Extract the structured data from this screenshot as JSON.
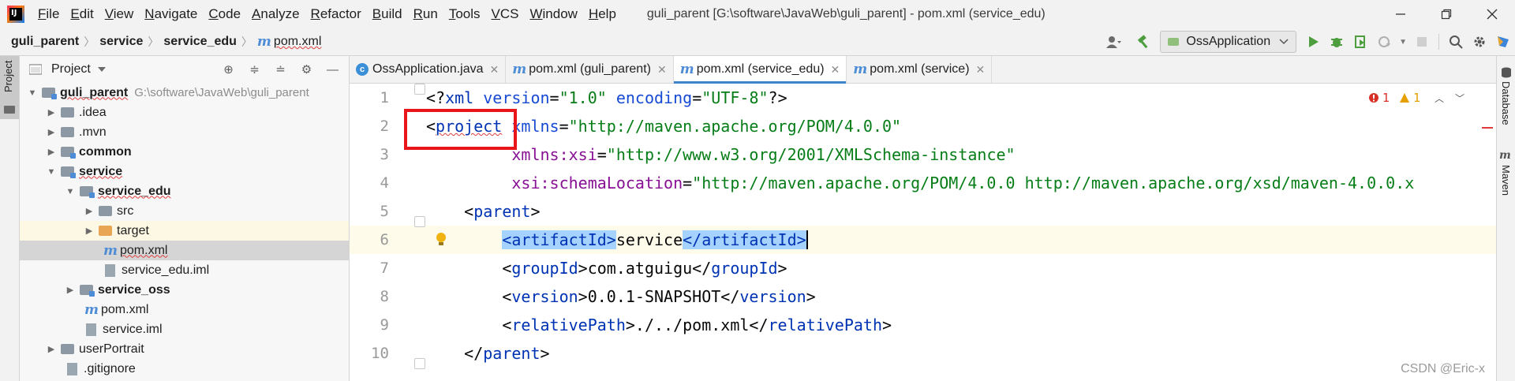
{
  "menu": [
    "File",
    "Edit",
    "View",
    "Navigate",
    "Code",
    "Analyze",
    "Refactor",
    "Build",
    "Run",
    "Tools",
    "VCS",
    "Window",
    "Help"
  ],
  "window_title": "guli_parent [G:\\software\\JavaWeb\\guli_parent] - pom.xml (service_edu)",
  "breadcrumb": [
    "guli_parent",
    "service",
    "service_edu",
    "pom.xml"
  ],
  "run_config": "OssApplication",
  "left_strip_label": "Project",
  "project_panel": {
    "title": "Project",
    "root": {
      "name": "guli_parent",
      "path": "G:\\software\\JavaWeb\\guli_parent"
    },
    "items": [
      ".idea",
      ".mvn",
      "common",
      "service",
      "service_edu",
      "src",
      "target",
      "pom.xml",
      "service_edu.iml",
      "service_oss",
      "pom.xml",
      "service.iml",
      "userPortrait",
      ".gitignore"
    ]
  },
  "tabs": [
    {
      "label": "OssApplication.java",
      "icon": "class-icon"
    },
    {
      "label": "pom.xml (guli_parent)",
      "icon": "maven-icon"
    },
    {
      "label": "pom.xml (service_edu)",
      "icon": "maven-icon",
      "active": true
    },
    {
      "label": "pom.xml (service)",
      "icon": "maven-icon"
    }
  ],
  "right_strip": [
    "Database",
    "Maven"
  ],
  "inspection": {
    "errors": "1",
    "warnings": "1"
  },
  "editor": {
    "line_numbers": [
      "1",
      "2",
      "3",
      "4",
      "5",
      "6",
      "7",
      "8",
      "9",
      "10"
    ],
    "l1": {
      "a": "<?",
      "b": "xml",
      "c": " version",
      "d": "=",
      "e": "\"1.0\"",
      "f": " encoding",
      "g": "=",
      "h": "\"UTF-8\"",
      "i": "?>"
    },
    "l2": {
      "a": "<",
      "b": "project",
      "c": " xmlns",
      "d": "=",
      "e": "\"http://maven.apache.org/POM/4.0.0\""
    },
    "l3": {
      "a": "         xmlns:xsi",
      "b": "=",
      "c": "\"http://www.w3.org/2001/XMLSchema-instance\""
    },
    "l4": {
      "a": "         xsi:schemaLocation",
      "b": "=",
      "c": "\"http://maven.apache.org/POM/4.0.0 http://maven.apache.org/xsd/maven-4.0.0.x"
    },
    "l5": {
      "a": "    <",
      "b": "parent",
      "c": ">"
    },
    "l6": {
      "a": "        ",
      "b": "<artifactId>",
      "c": "service",
      "d": "</artifactId>"
    },
    "l7": {
      "a": "        <",
      "b": "groupId",
      "c": ">com.atguigu</",
      "d": "groupId",
      "e": ">"
    },
    "l8": {
      "a": "        <",
      "b": "version",
      "c": ">0.0.1-SNAPSHOT</",
      "d": "version",
      "e": ">"
    },
    "l9": {
      "a": "        <",
      "b": "relativePath",
      "c": ">./../pom.xml</",
      "d": "relativePath",
      "e": ">"
    },
    "l10": {
      "a": "    </",
      "b": "parent",
      "c": ">"
    }
  },
  "watermark": "CSDN @Eric-x"
}
